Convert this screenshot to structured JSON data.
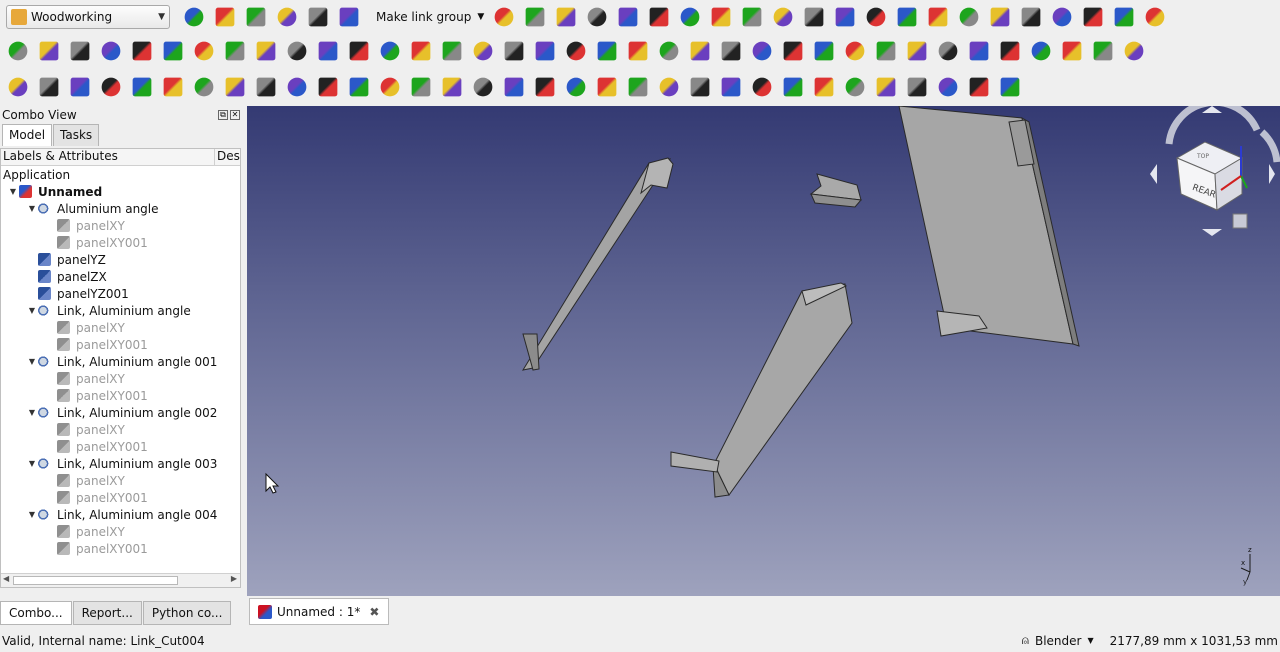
{
  "toolbar": {
    "workbench": "Woodworking",
    "link_group": "Make link group",
    "row1_icons": [
      "new-document-icon",
      "open-icon",
      "save-icon",
      "export-icon",
      "add-part-icon",
      "folder-icon"
    ],
    "row1b_icons": [
      "refresh-icon",
      "workbench-search-icon",
      "bug-icon",
      "node-icon",
      "macro-record-icon",
      "macro-stop-icon",
      "macro-edit-icon",
      "macro-run-icon",
      "list-icon",
      "cube-icon",
      "cube-group-icon",
      "cube-blue-icon",
      "cube-red-icon",
      "cube-stack-icon",
      "grid-icon",
      "tree-icon",
      "ruler-icon",
      "diamond-icon",
      "mirror-icon",
      "parts-icon",
      "parts-gold-icon",
      "std-view-icon"
    ],
    "row2_icons": [
      "panel-xy-icon",
      "panel-yz-icon",
      "panel-xz-icon",
      "panel-copy-icon",
      "panel-copy2-icon",
      "panel-copy3-icon",
      "frame-icon",
      "frame2-icon",
      "frame3-icon",
      "frame4-icon",
      "frame5-icon",
      "frame6-icon",
      "position-icon",
      "cylinder-icon",
      "hole-icon",
      "eraser-icon",
      "remove-icon",
      "line-icon",
      "green-box-icon",
      "wood-icon",
      "plane-icon",
      "box-red-icon",
      "box-red2-icon",
      "box-blue-icon",
      "spheres-icon",
      "torus-icon",
      "cone-icon",
      "sphere-icon",
      "color-cube-icon",
      "pattern-icon",
      "slab-icon",
      "spacer-icon",
      "print-icon",
      "code-icon",
      "magnet-icon",
      "magnet2-icon",
      "inspect-icon"
    ],
    "row3_icons": [
      "move-x-icon",
      "move-y-icon",
      "move-z-icon",
      "rotate-x-icon",
      "rotate-y-icon",
      "rotate-z-icon",
      "resize-icon",
      "resize2-icon",
      "resize3-icon",
      "resize4-icon",
      "resize5-icon",
      "resize6-icon",
      "plus-icon",
      "minus-icon",
      "plus2-icon",
      "minus2-icon",
      "axis-icon",
      "plane-green-icon",
      "arrow-down-icon",
      "diag-icon",
      "diag2-icon",
      "diag3-icon",
      "diag4-icon",
      "vline-icon",
      "vline2-icon",
      "frame-pick-icon",
      "question-icon",
      "edge-icon",
      "edge2-icon",
      "edge3-icon",
      "corner-icon",
      "corner2-icon",
      "corner3-icon"
    ]
  },
  "combo": {
    "title": "Combo View",
    "tabs": [
      "Model",
      "Tasks"
    ],
    "columns": [
      "Labels & Attributes",
      "Des"
    ],
    "application": "Application",
    "tree": [
      {
        "label": "Unnamed",
        "level": 0,
        "type": "doc",
        "expanded": true,
        "bold": true
      },
      {
        "label": "Aluminium angle",
        "level": 1,
        "type": "link",
        "expanded": true
      },
      {
        "label": "panelXY",
        "level": 2,
        "type": "grey",
        "dim": true
      },
      {
        "label": "panelXY001",
        "level": 2,
        "type": "grey",
        "dim": true
      },
      {
        "label": "panelYZ",
        "level": 1,
        "type": "panel"
      },
      {
        "label": "panelZX",
        "level": 1,
        "type": "panel"
      },
      {
        "label": "panelYZ001",
        "level": 1,
        "type": "panel"
      },
      {
        "label": "Link, Aluminium angle",
        "level": 1,
        "type": "link",
        "expanded": true
      },
      {
        "label": "panelXY",
        "level": 2,
        "type": "grey",
        "dim": true
      },
      {
        "label": "panelXY001",
        "level": 2,
        "type": "grey",
        "dim": true
      },
      {
        "label": "Link, Aluminium angle 001",
        "level": 1,
        "type": "link",
        "expanded": true
      },
      {
        "label": "panelXY",
        "level": 2,
        "type": "grey",
        "dim": true
      },
      {
        "label": "panelXY001",
        "level": 2,
        "type": "grey",
        "dim": true
      },
      {
        "label": "Link, Aluminium angle 002",
        "level": 1,
        "type": "link",
        "expanded": true
      },
      {
        "label": "panelXY",
        "level": 2,
        "type": "grey",
        "dim": true
      },
      {
        "label": "panelXY001",
        "level": 2,
        "type": "grey",
        "dim": true
      },
      {
        "label": "Link, Aluminium angle 003",
        "level": 1,
        "type": "link",
        "expanded": true
      },
      {
        "label": "panelXY",
        "level": 2,
        "type": "grey",
        "dim": true
      },
      {
        "label": "panelXY001",
        "level": 2,
        "type": "grey",
        "dim": true
      },
      {
        "label": "Link, Aluminium angle 004",
        "level": 1,
        "type": "link",
        "expanded": true
      },
      {
        "label": "panelXY",
        "level": 2,
        "type": "grey",
        "dim": true
      },
      {
        "label": "panelXY001",
        "level": 2,
        "type": "grey",
        "dim": true
      }
    ],
    "bottom_tabs": [
      "Combo...",
      "Report...",
      "Python co..."
    ]
  },
  "view": {
    "nav_cube_face": "REAR",
    "nav_cube_top": "TOP",
    "axis": {
      "x": "x",
      "y": "y",
      "z": "z"
    }
  },
  "document_tab": {
    "label": "Unnamed : 1*"
  },
  "status": {
    "message": "Valid, Internal name: Link_Cut004",
    "navigation": "Blender",
    "dimensions": "2177,89 mm x 1031,53 mm"
  },
  "colors": {
    "view_top": "#343a73",
    "view_bottom": "#9ea2bd",
    "part_face": "#a8a8a8",
    "part_edge": "#2a2a2a"
  }
}
